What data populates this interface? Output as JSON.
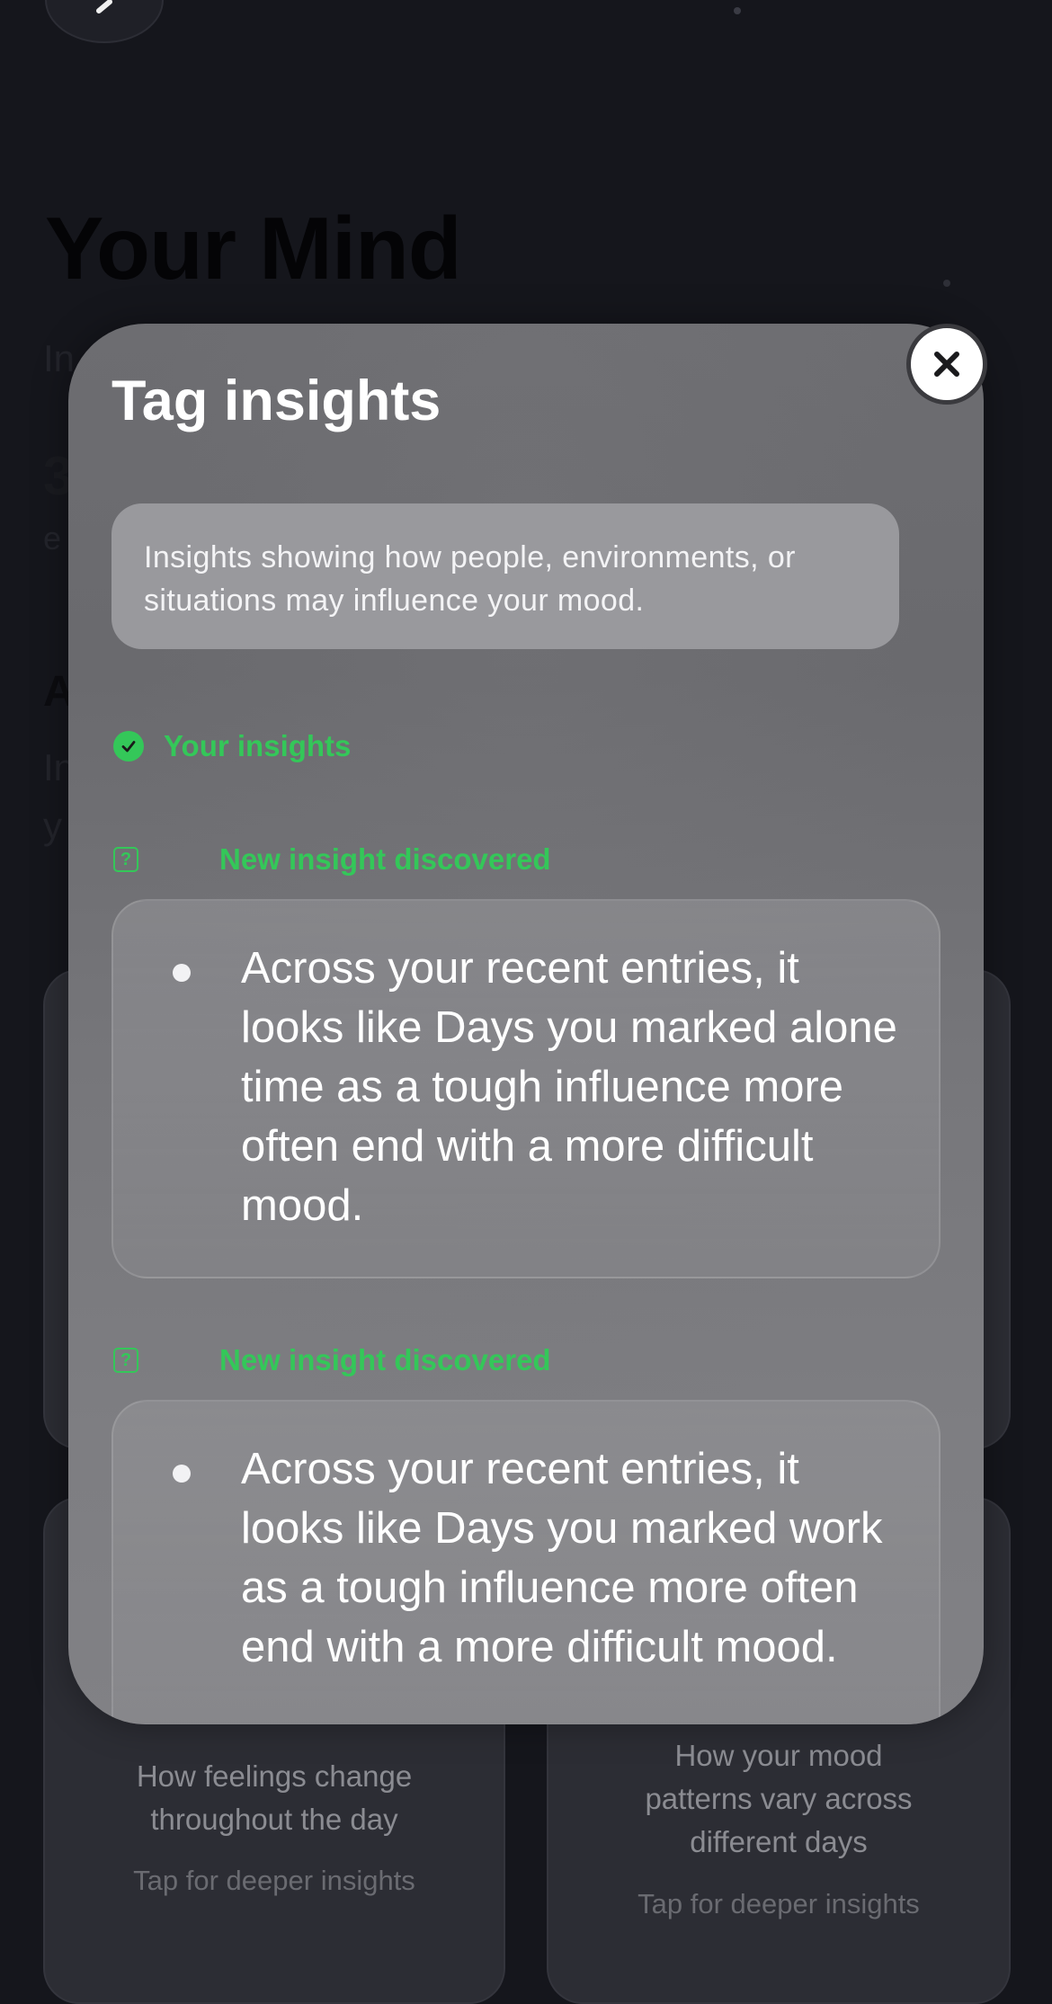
{
  "background": {
    "page_title": "Your Mind",
    "cards": [
      {
        "description": "How feelings change throughout the day",
        "tap_hint": "Tap for deeper insights"
      },
      {
        "description": "How your mood patterns vary across different days",
        "tap_hint": "Tap for deeper insights"
      }
    ]
  },
  "modal": {
    "title": "Tag insights",
    "intro": "Insights showing how people, environments, or situations may influence your mood.",
    "section_label": "Your insights",
    "insights": [
      {
        "label": "New insight discovered",
        "text": "Across your recent entries, it looks like Days you marked alone time as a tough influence more often end with a more difficult mood."
      },
      {
        "label": "New insight discovered",
        "text": "Across your recent entries, it looks like Days you marked work as a tough influence more often end with a more difficult mood."
      }
    ]
  },
  "colors": {
    "accent_green": "#34c759",
    "background": "#15161c"
  },
  "icons": {
    "close": "close-icon",
    "back": "chevron-left-icon",
    "section": "checkmark-circle-icon",
    "insight": "question-square-icon"
  }
}
